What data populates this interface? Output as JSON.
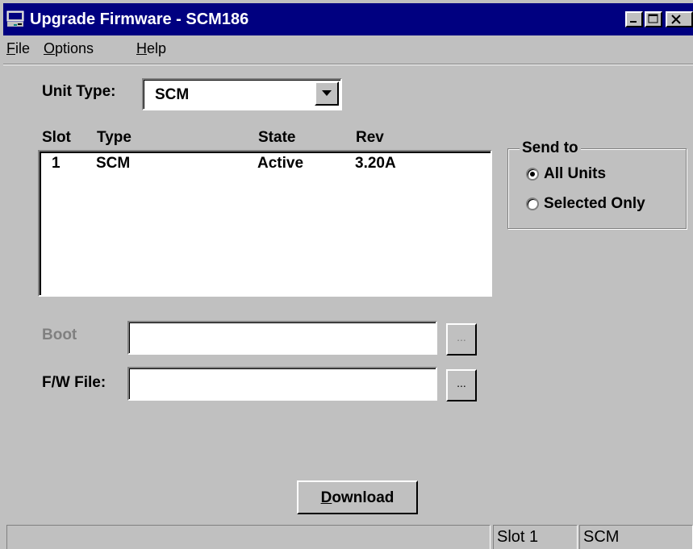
{
  "window": {
    "title": "Upgrade Firmware - SCM186",
    "controls": [
      "minimize",
      "maximize",
      "close"
    ]
  },
  "menu": [
    {
      "label": "File",
      "mnemonic": "F",
      "rest": "ile"
    },
    {
      "label": "Options",
      "mnemonic": "O",
      "rest": "ptions"
    },
    {
      "label": "Help",
      "mnemonic": "H",
      "rest": "elp"
    }
  ],
  "unit_type": {
    "label": "Unit Type:",
    "value": "SCM"
  },
  "table": {
    "headers": [
      "Slot",
      "Type",
      "State",
      "Rev"
    ],
    "rows": [
      [
        "1",
        "SCM",
        "Active",
        "3.20A"
      ]
    ]
  },
  "send_to": {
    "title": "Send to",
    "options": [
      {
        "label": "All Units",
        "selected": true
      },
      {
        "label": "Selected Only",
        "selected": false
      }
    ]
  },
  "boot": {
    "label": "Boot",
    "value": "",
    "browse": "...",
    "enabled": false
  },
  "fw_file": {
    "label": "F/W File:",
    "value": "",
    "browse": "..."
  },
  "download": {
    "label": "Download",
    "mnemonic": "D",
    "rest": "ownload"
  },
  "status_bar": {
    "panel1": "",
    "slot": "Slot 1",
    "unit": "SCM"
  }
}
